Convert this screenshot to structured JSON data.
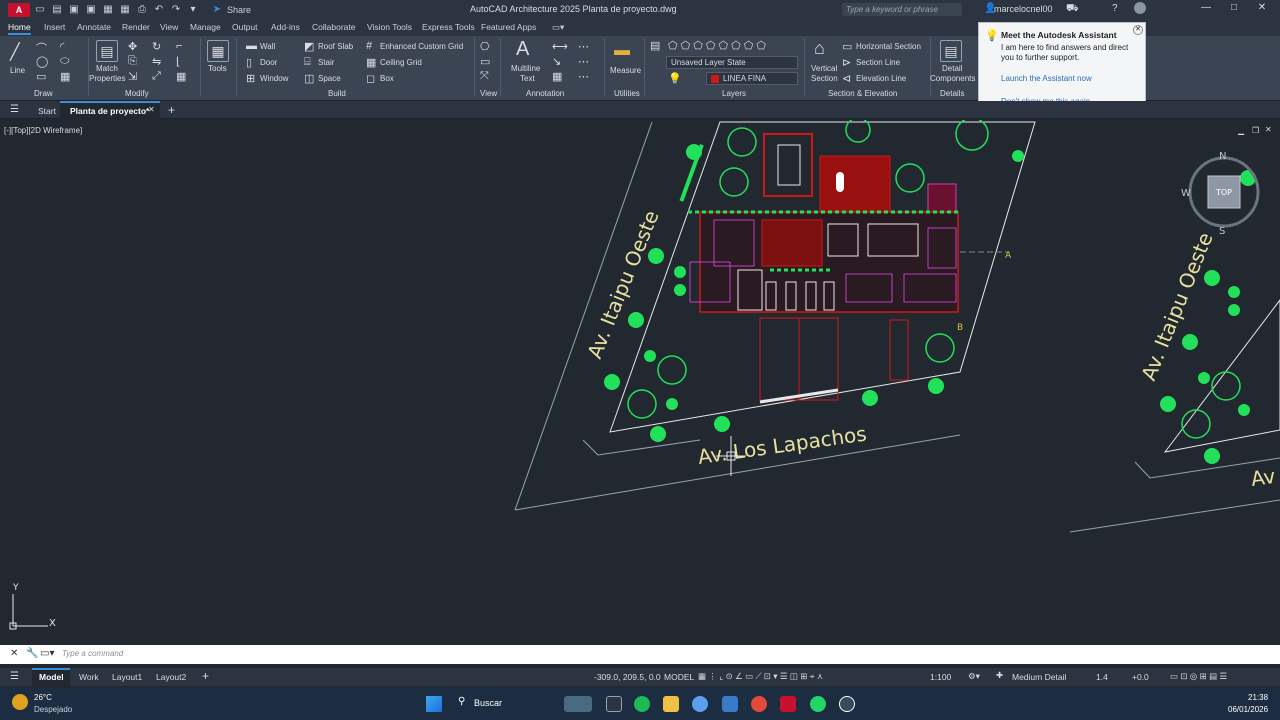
{
  "title_bar": {
    "app_logo": "A",
    "share_label": "Share",
    "window_title": "AutoCAD Architecture 2025   Planta de proyecto.dwg",
    "search_placeholder": "Type a keyword or phrase",
    "user": "marcelocnel00"
  },
  "ribbon_tabs": [
    "Home",
    "Insert",
    "Annotate",
    "Render",
    "View",
    "Manage",
    "Output",
    "Add-ins",
    "Collaborate",
    "Vision Tools",
    "Express Tools",
    "Featured Apps"
  ],
  "ribbon": {
    "draw": {
      "line": "Line",
      "panel": "Draw"
    },
    "modify": {
      "match_properties_1": "Match",
      "match_properties_2": "Properties",
      "panel": "Modify"
    },
    "tools": "Tools",
    "build": {
      "wall": "Wall",
      "door": "Door",
      "window": "Window",
      "roof_slab": "Roof Slab",
      "stair": "Stair",
      "space": "Space",
      "enhanced_grid": "Enhanced Custom Grid",
      "ceiling_grid": "Ceiling Grid",
      "box": "Box",
      "panel": "Build"
    },
    "view_panel": "View",
    "annotation": {
      "multiline_1": "Multiline",
      "multiline_2": "Text",
      "panel": "Annotation"
    },
    "utilities": {
      "measure": "Measure",
      "panel": "Utilities"
    },
    "layers": {
      "state": "Unsaved Layer State",
      "current": "LINEA FINA",
      "panel": "Layers"
    },
    "section": {
      "vertical_1": "Vertical",
      "vertical_2": "Section",
      "horizontal": "Horizontal Section",
      "section_line": "Section Line",
      "elevation_line": "Elevation Line",
      "panel": "Section & Elevation"
    },
    "details": {
      "detail_1": "Detail",
      "detail_2": "Components",
      "panel": "Details"
    }
  },
  "assistant": {
    "title": "Meet the Autodesk Assistant",
    "body": "I am here to find answers and direct you to further support.",
    "launch_link": "Launch the Assistant now",
    "dismiss_link": "Don't show me this again"
  },
  "doc_tabs": {
    "start": "Start",
    "current": "Planta de proyecto*"
  },
  "viewport_label": "[-][Top][2D Wireframe]",
  "drawing": {
    "street_1": "Av. Itaipu Oeste",
    "street_2": "Av. Los Lapachos",
    "street_1_right": "Av. Itaipu Oeste",
    "street_2_right": "Av",
    "marker_a": "A",
    "marker_b": "B"
  },
  "viewcube": {
    "n": "N",
    "s": "S",
    "w": "W",
    "top": "TOP"
  },
  "ucs": {
    "y": "Y",
    "x": "X"
  },
  "command": {
    "placeholder": "Type a command"
  },
  "status": {
    "tabs": [
      "Model",
      "Work",
      "Layout1",
      "Layout2"
    ],
    "coords": "-309.0, 209.5, 0.0",
    "model": "MODEL",
    "scale": "1:100",
    "detail": "Medium Detail",
    "lineweight": "1.4",
    "offset": "+0.0"
  },
  "taskbar": {
    "temperature": "26°C",
    "weather": "Despejado",
    "search": "Buscar",
    "time": "21:38",
    "date": "06/01/2026"
  },
  "colors": {
    "tree": "#22e05a",
    "building_red": "#d01818",
    "accent": "#3b8fd9",
    "purple": "#c040c0"
  }
}
